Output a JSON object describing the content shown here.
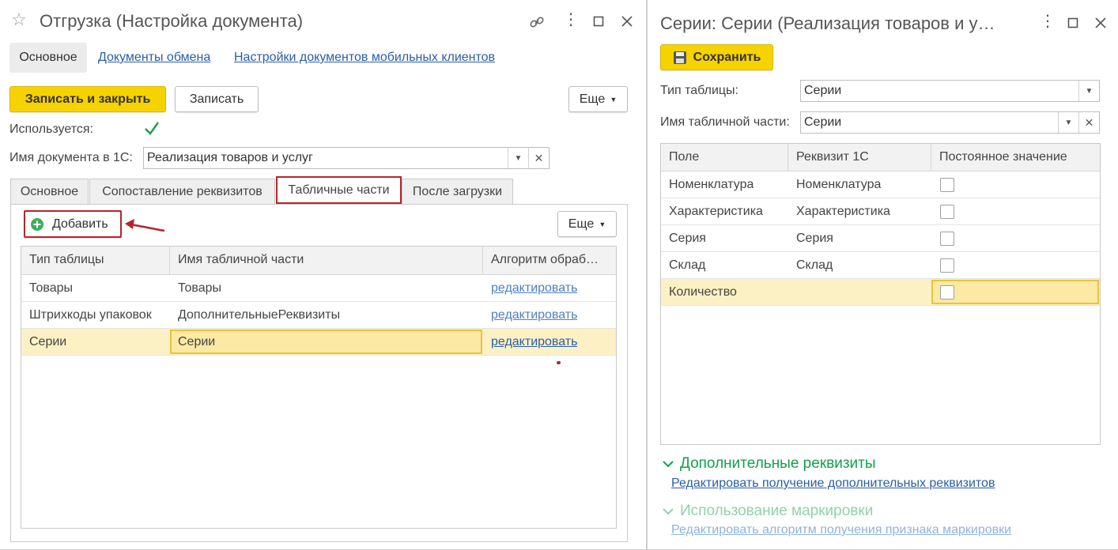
{
  "left_window": {
    "title": "Отгрузка (Настройка документа)",
    "nav": {
      "active": "Основное",
      "links": [
        "Документы обмена",
        "Настройки документов мобильных клиентов"
      ]
    },
    "toolbar": {
      "save_close": "Записать и закрыть",
      "save": "Записать",
      "more": "Еще"
    },
    "used_label": "Используется:",
    "used_checked": true,
    "docname_label": "Имя документа в 1С:",
    "docname_value": "Реализация товаров и услуг",
    "tabs": [
      "Основное",
      "Сопоставление реквизитов",
      "Табличные части",
      "После загрузки"
    ],
    "add_button": "Добавить",
    "more_button": "Еще",
    "table": {
      "headers": [
        "Тип таблицы",
        "Имя табличной части",
        "Алгоритм обраб…"
      ],
      "rows": [
        {
          "type": "Товары",
          "name": "Товары",
          "algo": "редактировать"
        },
        {
          "type": "Штрихкоды упаковок",
          "name": "ДополнительныеРеквизиты",
          "algo": "редактировать"
        },
        {
          "type": "Серии",
          "name": "Серии",
          "algo": "редактировать"
        }
      ]
    }
  },
  "right_window": {
    "title": "Серии: Серии (Реализация товаров и у…",
    "save_button": "Сохранить",
    "table_type_label": "Тип таблицы:",
    "table_type_value": "Серии",
    "table_part_label": "Имя табличной части:",
    "table_part_value": "Серии",
    "grid": {
      "headers": [
        "Поле",
        "Реквизит 1С",
        "Постоянное значение"
      ],
      "rows": [
        {
          "field": "Номенклатура",
          "attr": "Номенклатура"
        },
        {
          "field": "Характеристика",
          "attr": "Характеристика"
        },
        {
          "field": "Серия",
          "attr": "Серия"
        },
        {
          "field": "Склад",
          "attr": "Склад"
        },
        {
          "field": "Количество",
          "attr": ""
        }
      ]
    },
    "sections": {
      "extra_title": "Дополнительные реквизиты",
      "extra_link": "Редактировать получение дополнительных реквизитов",
      "marking_title": "Использование маркировки",
      "marking_link": "Редактировать алгоритм получения признака маркировки"
    }
  },
  "colors": {
    "accent_yellow": "#f6d200",
    "link_blue": "#2a5ea8",
    "section_green": "#12a04a",
    "highlight_red": "#b4262a"
  }
}
